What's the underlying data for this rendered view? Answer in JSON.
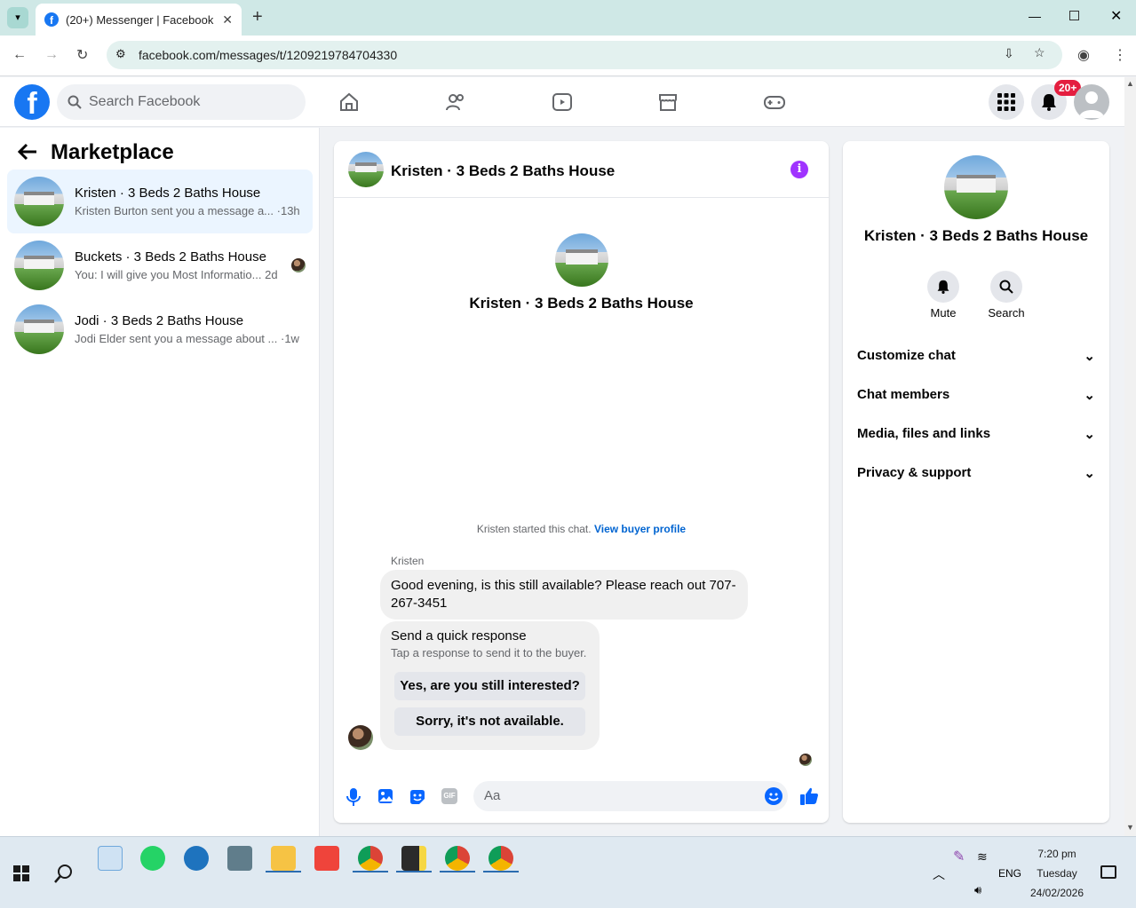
{
  "browser": {
    "tab_title": "(20+) Messenger | Facebook",
    "url": "facebook.com/messages/t/1209219784704330"
  },
  "fbnav": {
    "search_placeholder": "Search Facebook",
    "notif_badge": "20+",
    "accent": "#1877f2"
  },
  "sidebar": {
    "title": "Marketplace",
    "conversations": [
      {
        "name": "Kristen · 3 Beds 2 Baths House",
        "preview": "Kristen Burton sent you a message a...",
        "time": "·13h"
      },
      {
        "name": "Buckets · 3 Beds 2 Baths House",
        "preview": "You: I will give you Most Informatio...",
        "time": "2d"
      },
      {
        "name": "Jodi · 3 Beds 2 Baths House",
        "preview": "Jodi Elder sent you a message about ...",
        "time": "·1w"
      }
    ]
  },
  "chat": {
    "header_title": "Kristen · 3 Beds 2 Baths House",
    "intro_title": "Kristen · 3 Beds 2 Baths House",
    "started_text": "Kristen started this chat.",
    "view_profile": "View buyer profile",
    "sender": "Kristen",
    "message": "Good evening, is this still available? Please reach out 707-267-3451",
    "quick_title": "Send a quick response",
    "quick_sub": "Tap a response to send it to the buyer.",
    "quick_btn1": "Yes, are you still interested?",
    "quick_btn2": "Sorry, it's not available.",
    "input_placeholder": "Aa"
  },
  "details": {
    "title": "Kristen · 3 Beds 2 Baths House",
    "mute": "Mute",
    "search": "Search",
    "rows": [
      "Customize chat",
      "Chat members",
      "Media, files and links",
      "Privacy & support"
    ]
  },
  "taskbar": {
    "lang": "ENG",
    "time": "7:20 pm",
    "day": "Tuesday",
    "date": "24/02/2026"
  }
}
